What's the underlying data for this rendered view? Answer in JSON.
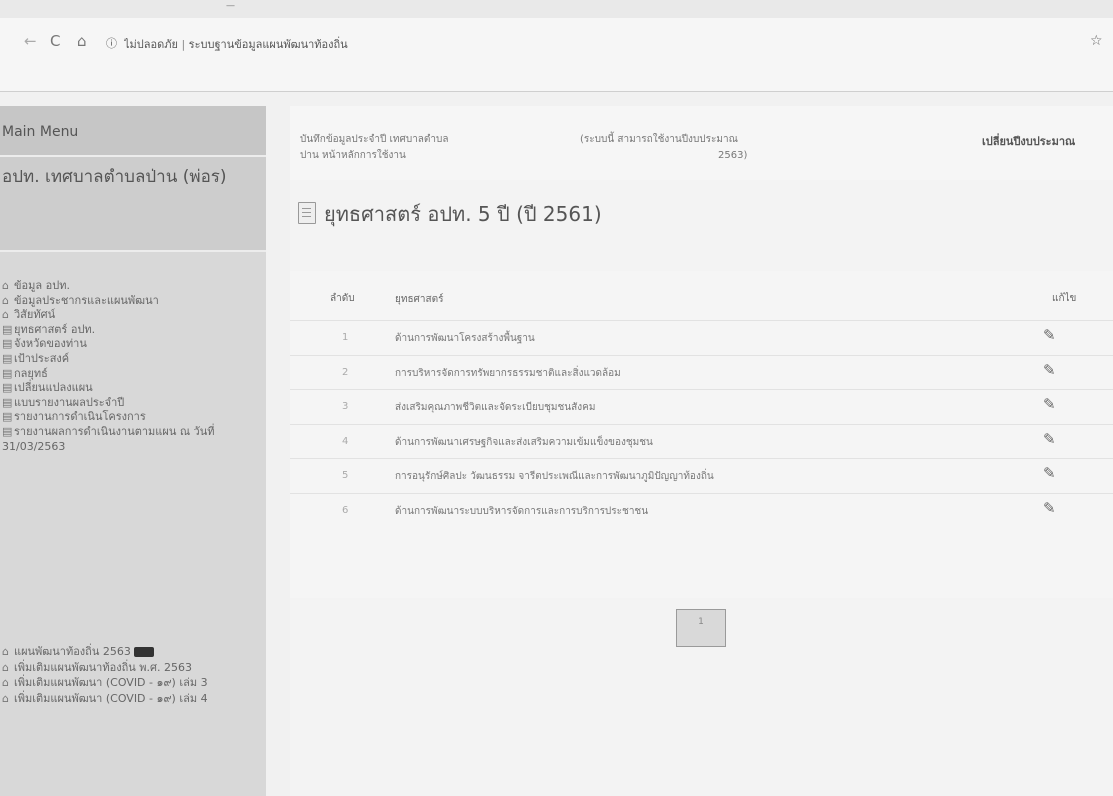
{
  "browser": {
    "site_info": "ไม่ปลอดภัย",
    "address_sep": "|",
    "address": "ระบบฐานข้อมูลแผนพัฒนาท้องถิ่น"
  },
  "sidebar": {
    "header": "Main Menu",
    "org": "อปท. เทศบาลตำบลป่าน (พ่อร)",
    "items": [
      {
        "icon": "home-icon",
        "label": "ข้อมูล อปท."
      },
      {
        "icon": "home-icon",
        "label": "ข้อมูลประชากรและแผนพัฒนา"
      },
      {
        "icon": "home-icon",
        "label": "วิสัยทัศน์"
      },
      {
        "icon": "doc-icon",
        "label": "ยุทธศาสตร์ อปท."
      },
      {
        "icon": "doc-icon",
        "label": "จังหวัดของท่าน"
      },
      {
        "icon": "doc-icon",
        "label": "เป้าประสงค์"
      },
      {
        "icon": "doc-icon",
        "label": "กลยุทธ์"
      },
      {
        "icon": "doc-icon",
        "label": "เปลี่ยนแปลงแผน"
      },
      {
        "icon": "doc-icon",
        "label": "แบบรายงานผลประจำปี"
      },
      {
        "icon": "doc-icon",
        "label": "รายงานการดำเนินโครงการ"
      },
      {
        "icon": "doc-icon",
        "label": "รายงานผลการดำเนินงานตามแผน ณ วันที่ 31/03/2563"
      }
    ],
    "items2": [
      {
        "icon": "home-icon",
        "label": "แผนพัฒนาท้องถิ่น 2563"
      },
      {
        "icon": "home-icon",
        "label": "เพิ่มเติมแผนพัฒนาท้องถิ่น พ.ศ. 2563"
      },
      {
        "icon": "home-icon",
        "label": "เพิ่มเติมแผนพัฒนา (COVID - ๑๙) เล่ม 3"
      },
      {
        "icon": "home-icon",
        "label": "เพิ่มเติมแผนพัฒนา (COVID - ๑๙) เล่ม 4"
      }
    ]
  },
  "info_bar": {
    "left": "บันทึกข้อมูลประจำปี เทศบาลตำบลปาน หน้าหลักการใช้งาน",
    "middle": "(ระบบนี้ สามารถใช้งานปีงบประมาณ",
    "middle_year": "2563)",
    "right_link": "เปลี่ยนปีงบประมาณ"
  },
  "page": {
    "title": "ยุทธศาสตร์ อปท. 5 ปี (ปี 2561)"
  },
  "table": {
    "col_no": "ลำดับ",
    "col_strategy": "ยุทธศาสตร์",
    "col_edit": "แก้ไข",
    "rows": [
      {
        "no": "1",
        "strategy": "ด้านการพัฒนาโครงสร้างพื้นฐาน"
      },
      {
        "no": "2",
        "strategy": "การบริหารจัดการทรัพยากรธรรมชาติและสิ่งแวดล้อม"
      },
      {
        "no": "3",
        "strategy": "ส่งเสริมคุณภาพชีวิตและจัดระเบียบชุมชนสังคม"
      },
      {
        "no": "4",
        "strategy": "ด้านการพัฒนาเศรษฐกิจและส่งเสริมความเข้มแข็งของชุมชน"
      },
      {
        "no": "5",
        "strategy": "การอนุรักษ์ศิลปะ วัฒนธรรม จารีตประเพณีและการพัฒนาภูมิปัญญาท้องถิ่น"
      },
      {
        "no": "6",
        "strategy": "ด้านการพัฒนาระบบบริหารจัดการและการบริการประชาชน"
      }
    ]
  },
  "pagination": {
    "label": "1"
  }
}
